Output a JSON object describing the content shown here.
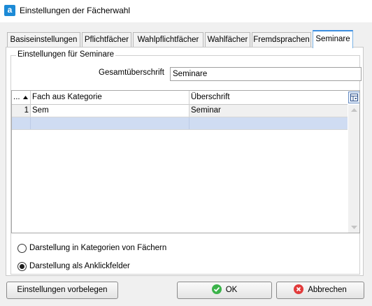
{
  "window": {
    "title": "Einstellungen der Fächerwahl",
    "app_icon_letter": "a"
  },
  "tabs": [
    {
      "label": "Basiseinstellungen",
      "active": false
    },
    {
      "label": "Pflichtfächer",
      "active": false
    },
    {
      "label": "Wahlpflichtfächer",
      "active": false
    },
    {
      "label": "Wahlfächer",
      "active": false
    },
    {
      "label": "Fremdsprachen",
      "active": false
    },
    {
      "label": "Seminare",
      "active": true
    }
  ],
  "group": {
    "legend": "Einstellungen für Seminare",
    "overall_heading_label": "Gesamtüberschrift",
    "overall_heading_value": "Seminare"
  },
  "grid": {
    "columns": [
      "...",
      "Fach aus Kategorie",
      "Überschrift"
    ],
    "rows": [
      {
        "num": "1",
        "fach": "Sem",
        "ueberschrift": "Seminar"
      },
      {
        "num": "",
        "fach": "",
        "ueberschrift": ""
      }
    ]
  },
  "options": {
    "display_categories": "Darstellung in Kategorien von Fächern",
    "display_clickfields": "Darstellung als Anklickfelder",
    "selected": "display_clickfields"
  },
  "buttons": {
    "defaults": "Einstellungen vorbelegen",
    "ok": "OK",
    "cancel": "Abbrechen"
  },
  "colors": {
    "accent": "#3c8ee0",
    "selected_row": "#cfdcf2",
    "ok_icon": "#3bb34a",
    "cancel_icon": "#e23b3b"
  }
}
